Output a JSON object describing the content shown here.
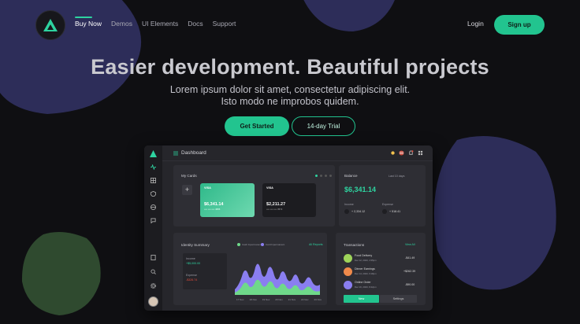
{
  "nav": {
    "links": [
      "Buy Now",
      "Demos",
      "UI Elements",
      "Docs",
      "Support"
    ],
    "login_label": "Login",
    "signup_label": "Sign up"
  },
  "hero": {
    "title": "Easier development. Beautiful projects",
    "subtitle_line1": "Lorem ipsum dolor sit amet, consectetur adipiscing elit.",
    "subtitle_line2": "Isto modo ne improbos quidem.",
    "cta_primary": "Get Started",
    "cta_secondary": "14-day Trial"
  },
  "colors": {
    "accent": "#22c48f",
    "background": "#0f0f12",
    "blob_purple": "#2d2d59",
    "blob_green": "#2f4a2f"
  },
  "dashboard": {
    "title": "Dashboard",
    "my_cards": {
      "title": "My Cards",
      "cards": [
        {
          "brand": "VISA",
          "amount": "$6,341.14",
          "number": "•••• •••• •••• 4886"
        },
        {
          "brand": "VISA",
          "amount": "$2,211.27",
          "number": "•••• •••• •••• 3572"
        }
      ]
    },
    "balance": {
      "title": "Balance",
      "range": "Last 10 days",
      "value": "$6,341.14",
      "income_label": "Income",
      "income_value": "+ 2,334.12",
      "expense_label": "Expense",
      "expense_value": "+ 518.41"
    },
    "identity": {
      "title": "Identity Summary",
      "link": "All Reports",
      "income_label": "Income",
      "income_value": "+$5,000.00",
      "expense_label": "Expense",
      "expense_value": "-$326.74",
      "legend": [
        "Cash Inpermanent",
        "Card Inpermanent"
      ],
      "x_labels": [
        "17 Nov",
        "18 Nov",
        "19 Nov",
        "20 Nov",
        "21 Nov",
        "22 Nov",
        "23 Nov"
      ]
    },
    "transactions": {
      "title": "Transactions",
      "link": "View All",
      "items": [
        {
          "name": "Food Delivery",
          "date": "Dec 12, 2020, 4:35pm",
          "amount": "-$41.49",
          "color": "#9ed45a"
        },
        {
          "name": "Dinner Earnings",
          "date": "Dec 14, 2020, 6:18pm",
          "amount": "+$262.39",
          "color": "#f08a4b"
        },
        {
          "name": "Online Order",
          "date": "Dec 16, 2020, 8:42pm",
          "amount": "-$90.00",
          "color": "#8a7ef0"
        }
      ],
      "tab_new": "New",
      "tab_settings": "Settings"
    }
  }
}
